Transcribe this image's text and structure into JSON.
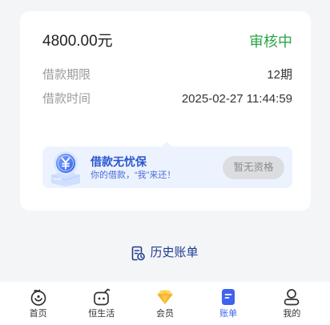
{
  "loan": {
    "amount": "4800.00元",
    "status": "审核中"
  },
  "details": [
    {
      "label": "借款期限",
      "value": "12期"
    },
    {
      "label": "借款时间",
      "value": "2025-02-27 11:44:59"
    }
  ],
  "promo": {
    "icon": "shield-yen-icon",
    "title": "借款无忧保",
    "subtitle": "你的借款，“我”来还！",
    "button_label": "暂无资格"
  },
  "history": {
    "icon": "bill-history-icon",
    "label": "历史账单"
  },
  "tabbar": {
    "items": [
      {
        "label": "首页",
        "icon": "home-icon",
        "active": false
      },
      {
        "label": "恒生活",
        "icon": "life-bag-icon",
        "active": false
      },
      {
        "label": "会员",
        "icon": "diamond-icon",
        "active": false
      },
      {
        "label": "账单",
        "icon": "bill-icon",
        "active": true
      },
      {
        "label": "我的",
        "icon": "profile-icon",
        "active": false
      }
    ]
  },
  "colors": {
    "background": "#f4f5f7",
    "status": "#2aa449",
    "accent": "#3f63ee",
    "promo_background": "#edf3fe",
    "promo_title": "#2b56cf",
    "history_link": "#1e3c8f",
    "member_gold": "#f4b52c"
  }
}
